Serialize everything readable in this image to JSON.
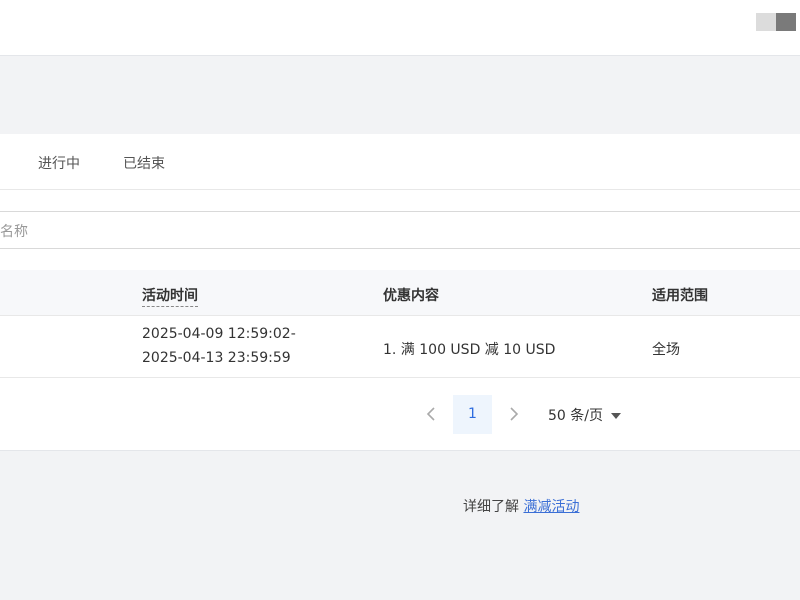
{
  "tabs": [
    {
      "label": "进行中"
    },
    {
      "label": "已结束"
    }
  ],
  "search": {
    "placeholder_visible": "名称"
  },
  "table": {
    "columns": [
      "活动时间",
      "优惠内容",
      "适用范围"
    ],
    "rows": [
      {
        "time_start": "2025-04-09 12:59:02-",
        "time_end": "2025-04-13 23:59:59",
        "content": "1. 满 100 USD 减 10 USD",
        "scope": "全场"
      }
    ]
  },
  "pagination": {
    "prev_icon": "chevron-left-icon",
    "current_page": "1",
    "next_icon": "chevron-right-icon",
    "page_size_label": "50 条/页"
  },
  "footer": {
    "text": "详细了解",
    "link": "满减活动"
  },
  "colors": {
    "accent": "#2d6cdf",
    "link": "#3b6fd6",
    "page_bg": "#f2f3f5"
  }
}
